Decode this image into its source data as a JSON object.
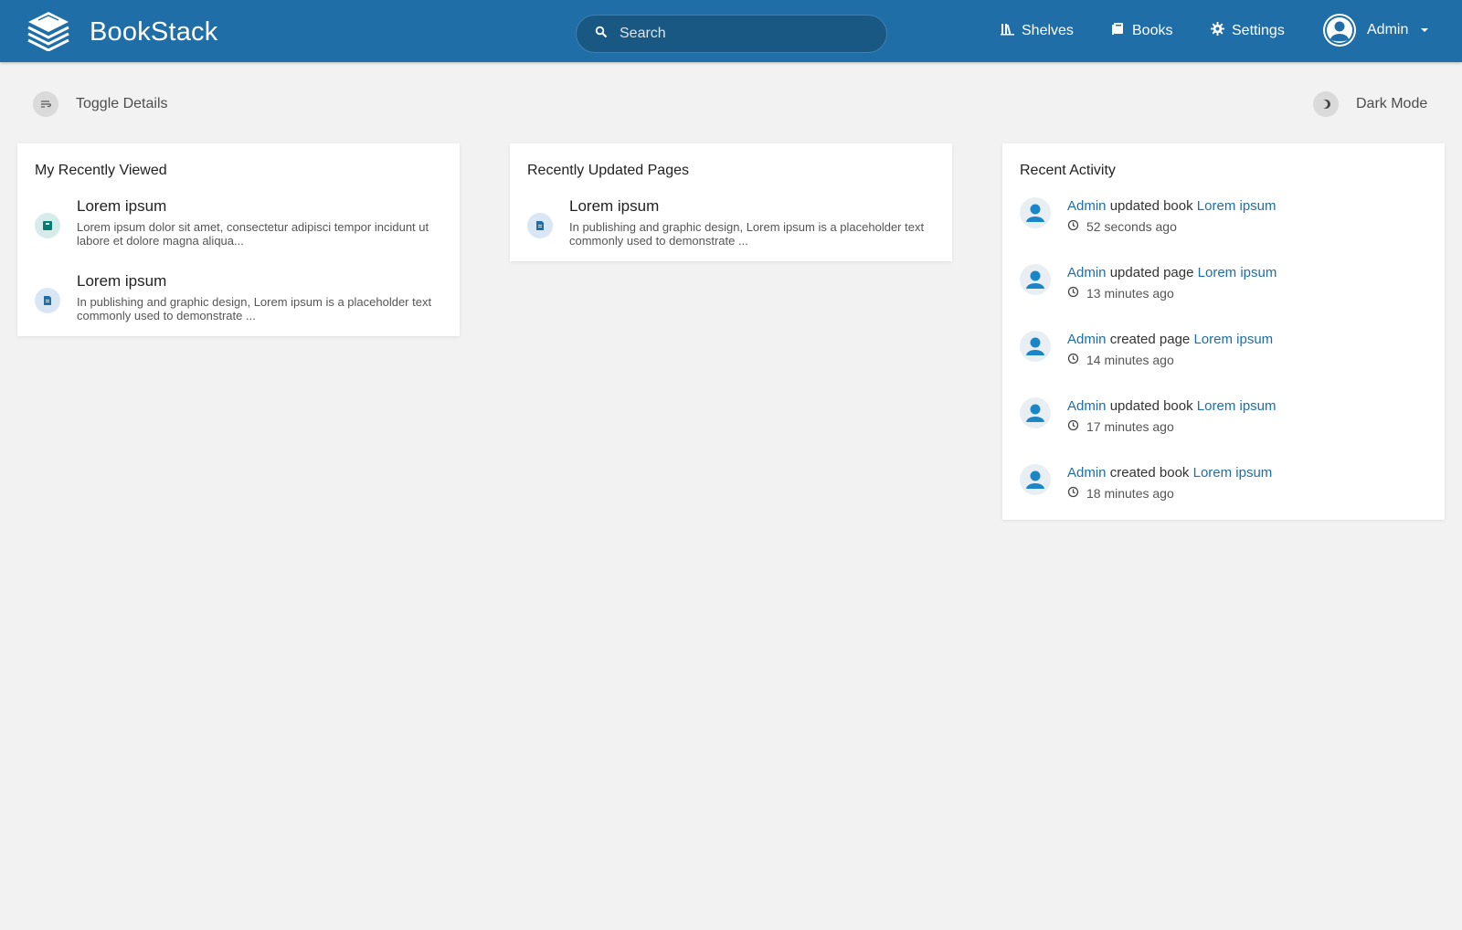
{
  "header": {
    "app_name": "BookStack",
    "logo_icon": "bookstack-logo-icon",
    "search_placeholder": "Search",
    "nav": [
      {
        "label": "Shelves",
        "icon": "shelves-icon"
      },
      {
        "label": "Books",
        "icon": "book-icon"
      },
      {
        "label": "Settings",
        "icon": "gear-icon"
      }
    ],
    "user": {
      "name": "Admin"
    }
  },
  "toolbar": {
    "toggle_details": "Toggle Details",
    "dark_mode": "Dark Mode"
  },
  "recently_viewed": {
    "title": "My Recently Viewed",
    "items": [
      {
        "type": "book",
        "name": "Lorem ipsum",
        "description": "Lorem ipsum dolor sit amet, consectetur adipisci tempor incidunt ut labore et dolore magna aliqua..."
      },
      {
        "type": "page",
        "name": "Lorem ipsum",
        "description": "In publishing and graphic design, Lorem ipsum is a placeholder text commonly used to demonstrate ..."
      }
    ]
  },
  "recently_updated": {
    "title": "Recently Updated Pages",
    "items": [
      {
        "type": "page",
        "name": "Lorem ipsum",
        "description": "In publishing and graphic design, Lorem ipsum is a placeholder text commonly used to demonstrate ..."
      }
    ]
  },
  "recent_activity": {
    "title": "Recent Activity",
    "items": [
      {
        "user": "Admin",
        "action": "updated book",
        "target": "Lorem ipsum",
        "time": "52 seconds ago"
      },
      {
        "user": "Admin",
        "action": "updated page",
        "target": "Lorem ipsum",
        "time": "13 minutes ago"
      },
      {
        "user": "Admin",
        "action": "created page",
        "target": "Lorem ipsum",
        "time": "14 minutes ago"
      },
      {
        "user": "Admin",
        "action": "updated book",
        "target": "Lorem ipsum",
        "time": "17 minutes ago"
      },
      {
        "user": "Admin",
        "action": "created book",
        "target": "Lorem ipsum",
        "time": "18 minutes ago"
      }
    ]
  },
  "colors": {
    "header_bg": "#206ea7",
    "link": "#206ea7",
    "book": "#077b70",
    "page": "#206ea7",
    "page_bg": "#f2f2f2"
  }
}
